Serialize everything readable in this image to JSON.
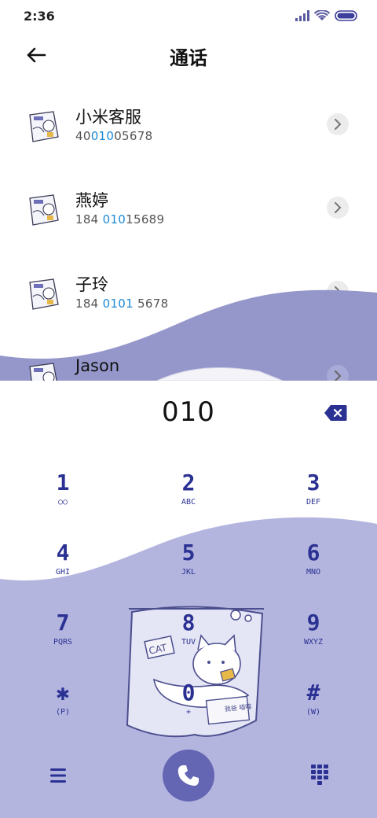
{
  "status_bar": {
    "time": "2:36",
    "icons": [
      "signal-icon",
      "wifi-icon",
      "battery-icon"
    ]
  },
  "header": {
    "title": "通话",
    "back_icon": "back-arrow-icon"
  },
  "contacts": [
    {
      "name": "小米客服",
      "number_parts": [
        "40",
        "010",
        "05678"
      ]
    },
    {
      "name": "燕婷",
      "number_parts": [
        "184 ",
        "010",
        "15689"
      ]
    },
    {
      "name": "子玲",
      "number_parts": [
        "184 ",
        "0101",
        " 5678"
      ]
    },
    {
      "name": "Jason",
      "number_parts": [
        "",
        "",
        ""
      ]
    }
  ],
  "dialer": {
    "input": "010",
    "keys": [
      {
        "digit": "1",
        "letters": "○○"
      },
      {
        "digit": "2",
        "letters": "ABC"
      },
      {
        "digit": "3",
        "letters": "DEF"
      },
      {
        "digit": "4",
        "letters": "GHI"
      },
      {
        "digit": "5",
        "letters": "JKL"
      },
      {
        "digit": "6",
        "letters": "MNO"
      },
      {
        "digit": "7",
        "letters": "PQRS"
      },
      {
        "digit": "8",
        "letters": "TUV"
      },
      {
        "digit": "9",
        "letters": "WXYZ"
      },
      {
        "digit": "✱",
        "letters": "(P)"
      },
      {
        "digit": "0",
        "letters": "+"
      },
      {
        "digit": "#",
        "letters": "(W)"
      }
    ],
    "art_labels": {
      "tag": "CAT",
      "stamp": "我爸 喵喵"
    }
  },
  "colors": {
    "accent": "#2b3193",
    "wave": "#9597cb",
    "wave_light": "#b3b5df",
    "call_button": "#6466b3",
    "number_highlight": "#1c8ad6"
  }
}
